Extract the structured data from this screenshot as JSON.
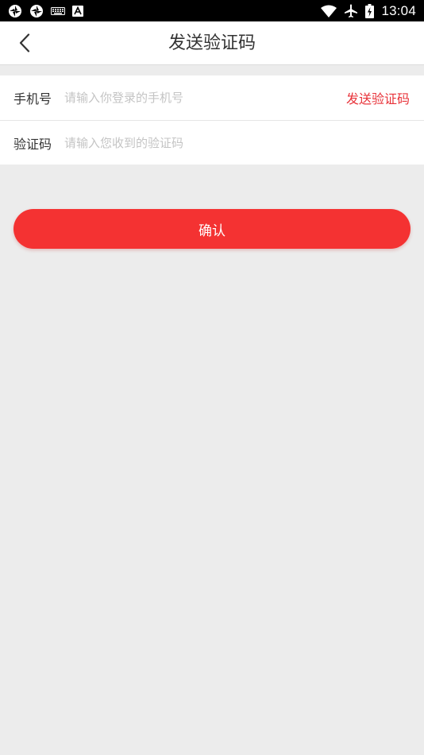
{
  "status_bar": {
    "time": "13:04",
    "icons_left": [
      "aperture-icon",
      "aperture-icon",
      "keyboard-icon",
      "font-a-icon"
    ],
    "icons_right": [
      "wifi-icon",
      "airplane-icon",
      "battery-icon"
    ]
  },
  "header": {
    "title": "发送验证码",
    "back_icon": "chevron-left-icon"
  },
  "form": {
    "phone": {
      "label": "手机号",
      "placeholder": "请输入你登录的手机号",
      "value": "",
      "send_code_label": "发送验证码"
    },
    "code": {
      "label": "验证码",
      "placeholder": "请输入您收到的验证码",
      "value": ""
    }
  },
  "confirm_label": "确认",
  "colors": {
    "accent": "#f43232",
    "link": "#e8333a",
    "background": "#ececec",
    "status_bar": "#000000"
  }
}
